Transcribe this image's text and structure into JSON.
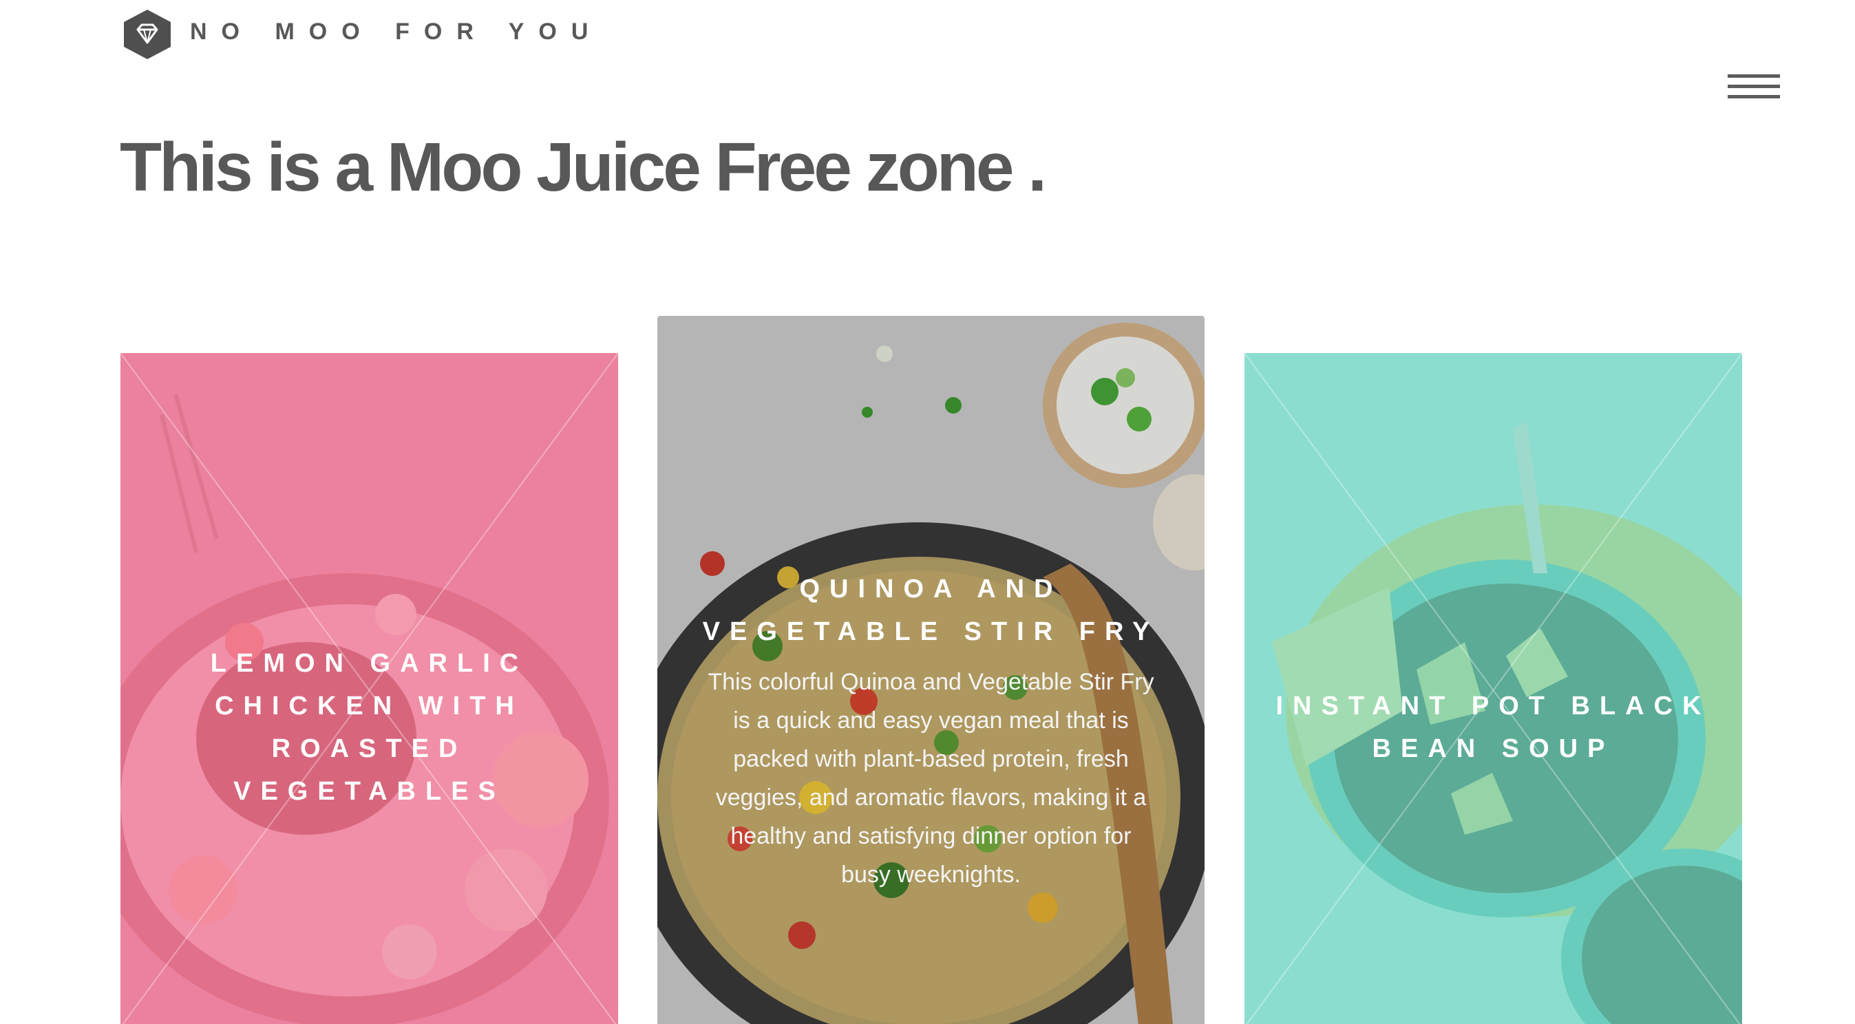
{
  "header": {
    "brand": "NO MOO FOR YOU",
    "logo_icon": "diamond-hexagon-icon",
    "menu_icon": "hamburger-menu-icon"
  },
  "hero": {
    "headline": "This is a Moo Juice Free zone ."
  },
  "cards": [
    {
      "title": "LEMON GARLIC CHICKEN WITH ROASTED VEGETABLES",
      "description": "",
      "overlay_color": "#ee8fa9"
    },
    {
      "title": "QUINOA AND VEGETABLE STIR FRY",
      "description": "This colorful Quinoa and Vegetable Stir Fry is a quick and easy vegan meal that is packed with plant-based protein, fresh veggies, and aromatic flavors, making it a healthy and satisfying dinner option for busy weeknights.",
      "overlay_color": "#9a9a9a"
    },
    {
      "title": "INSTANT POT BLACK BEAN SOUP",
      "description": "",
      "overlay_color": "#8fdcce"
    }
  ],
  "colors": {
    "text": "#585858",
    "background": "#ffffff"
  }
}
